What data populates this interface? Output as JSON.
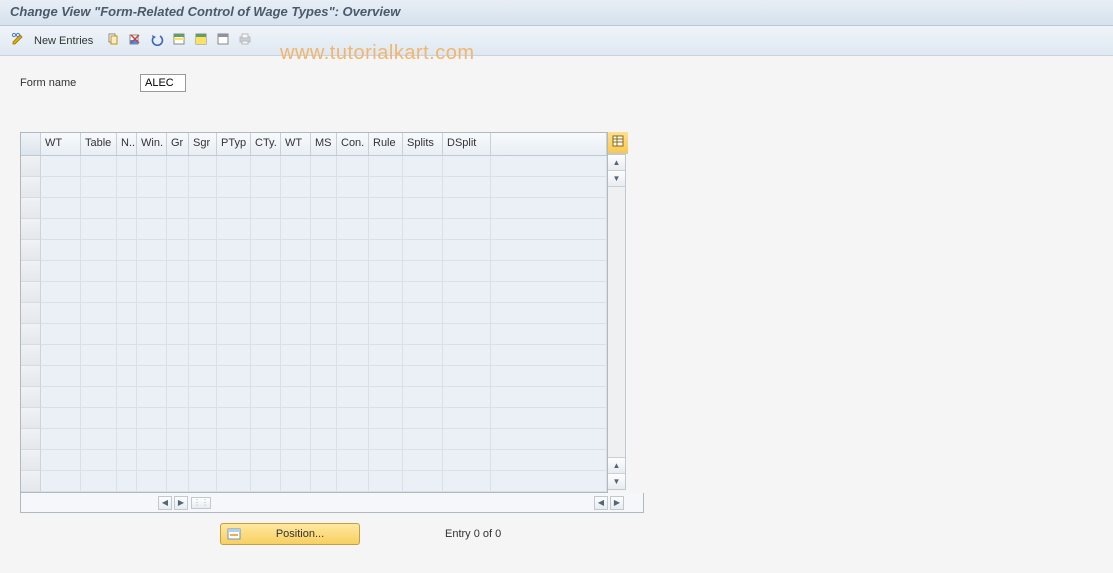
{
  "title": "Change View \"Form-Related Control of Wage Types\": Overview",
  "toolbar": {
    "new_entries_label": "New Entries"
  },
  "form": {
    "form_name_label": "Form name",
    "form_name_value": "ALEC"
  },
  "grid": {
    "columns": [
      "WT",
      "Table",
      "N..",
      "Win.",
      "Gr",
      "Sgr",
      "PTyp",
      "CTy.",
      "WT",
      "MS",
      "Con.",
      "Rule",
      "Splits",
      "DSplit"
    ],
    "row_count": 16
  },
  "footer": {
    "position_label": "Position...",
    "entry_status": "Entry 0 of 0"
  },
  "watermark": "www.tutorialkart.com"
}
